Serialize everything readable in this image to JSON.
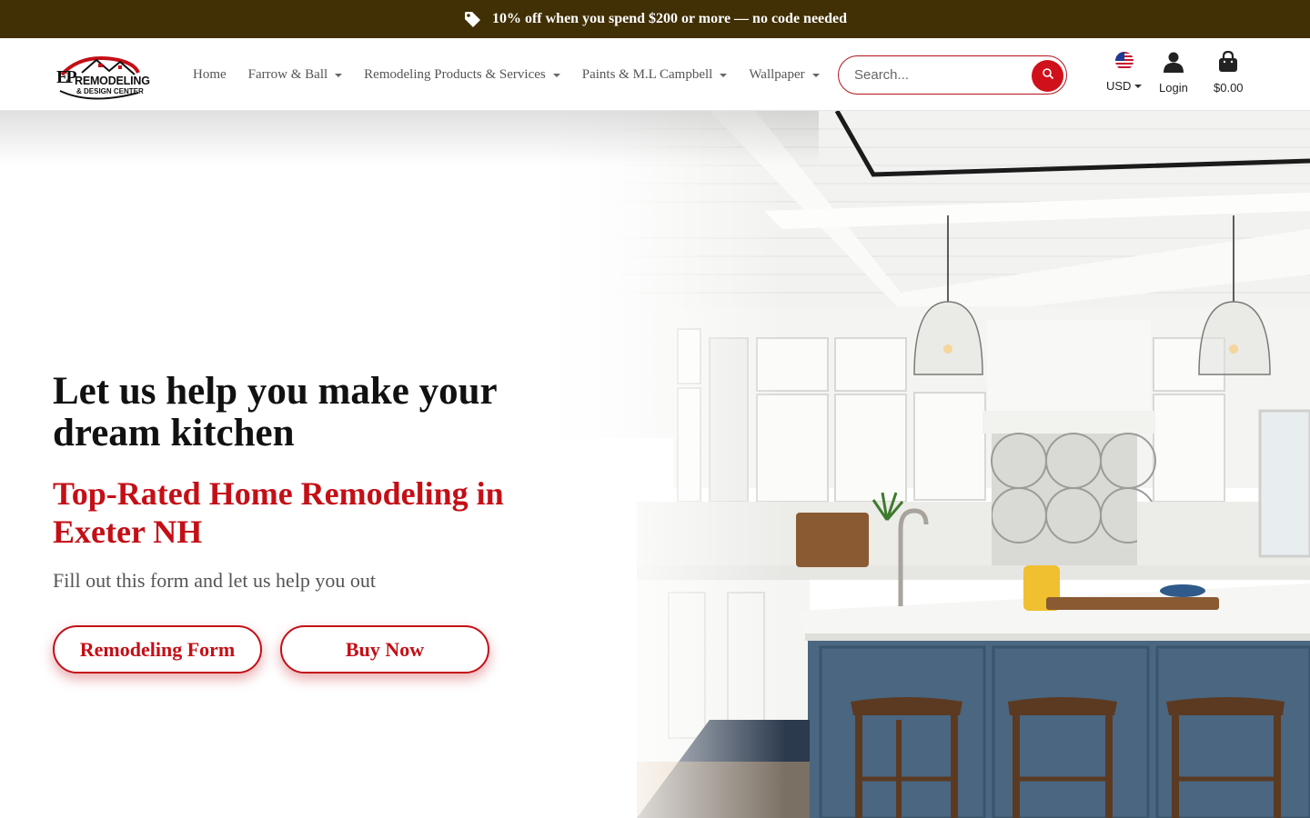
{
  "announcement": {
    "icon": "tag-icon",
    "text": "10% off when you spend $200 or more — no code needed"
  },
  "header": {
    "logo": {
      "line1": "REMODELING",
      "line2": "& DESIGN CENTER",
      "initials": "EP"
    },
    "nav": [
      {
        "label": "Home",
        "dropdown": false
      },
      {
        "label": "Farrow & Ball",
        "dropdown": true
      },
      {
        "label": "Remodeling Products & Services",
        "dropdown": true
      },
      {
        "label": "Paints & M.L Campbell",
        "dropdown": true
      },
      {
        "label": "Wallpaper",
        "dropdown": true
      }
    ],
    "search": {
      "placeholder": "Search...",
      "value": ""
    },
    "currency": {
      "label": "USD",
      "icon": "us-flag-icon"
    },
    "login": {
      "label": "Login",
      "icon": "user-icon"
    },
    "cart": {
      "label": "$0.00",
      "icon": "shopping-bag-icon"
    }
  },
  "hero": {
    "title": "Let us help you make your dream kitchen",
    "subtitle": "Top-Rated Home Remodeling in Exeter NH",
    "description": "Fill out this form and let us help you out",
    "buttons": [
      {
        "label": "Remodeling Form"
      },
      {
        "label": "Buy Now"
      }
    ]
  },
  "colors": {
    "announcement_bg": "#412f05",
    "accent_red": "#c40f17",
    "island_blue": "#4a6680"
  }
}
